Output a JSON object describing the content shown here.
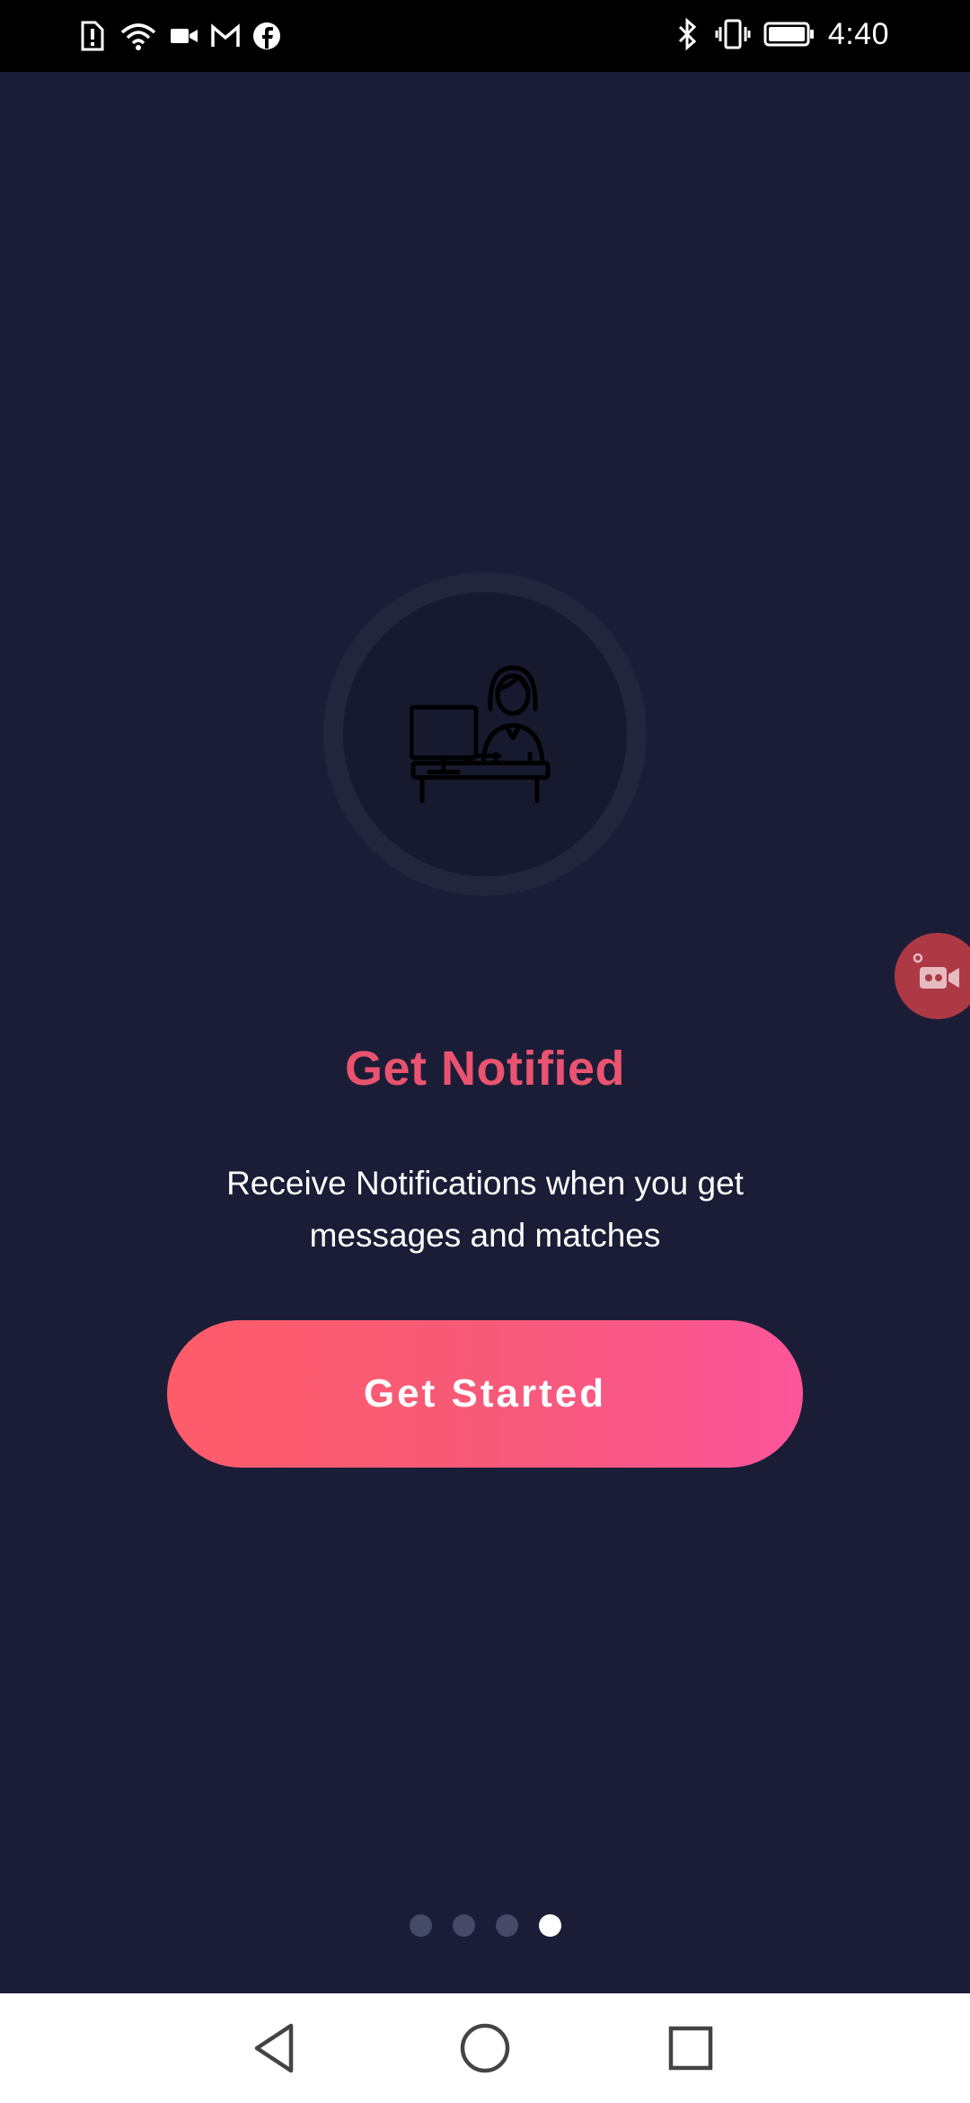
{
  "status_bar": {
    "time": "4:40",
    "left_icons": [
      "alert-sim-icon",
      "wifi-icon",
      "video-camera-icon",
      "gmail-icon",
      "facebook-icon"
    ],
    "right_icons": [
      "bluetooth-icon",
      "vibrate-icon",
      "battery-icon"
    ]
  },
  "onboarding": {
    "illustration": "woman-at-desk-icon",
    "title": "Get Notified",
    "subtitle": "Receive Notifications when you get messages and matches",
    "cta_label": "Get Started",
    "pagination": {
      "total": 4,
      "current": 4
    }
  },
  "floating_button": "screen-recorder-icon",
  "nav_bar": {
    "buttons": [
      "back-icon",
      "home-icon",
      "recents-icon"
    ]
  },
  "colors": {
    "background": "#1b1d37",
    "accent": "#ea5370",
    "button_gradient_start": "#ff5c6a",
    "button_gradient_end": "#fc5599",
    "dot_inactive": "#444a67",
    "dot_active": "#ffffff"
  }
}
